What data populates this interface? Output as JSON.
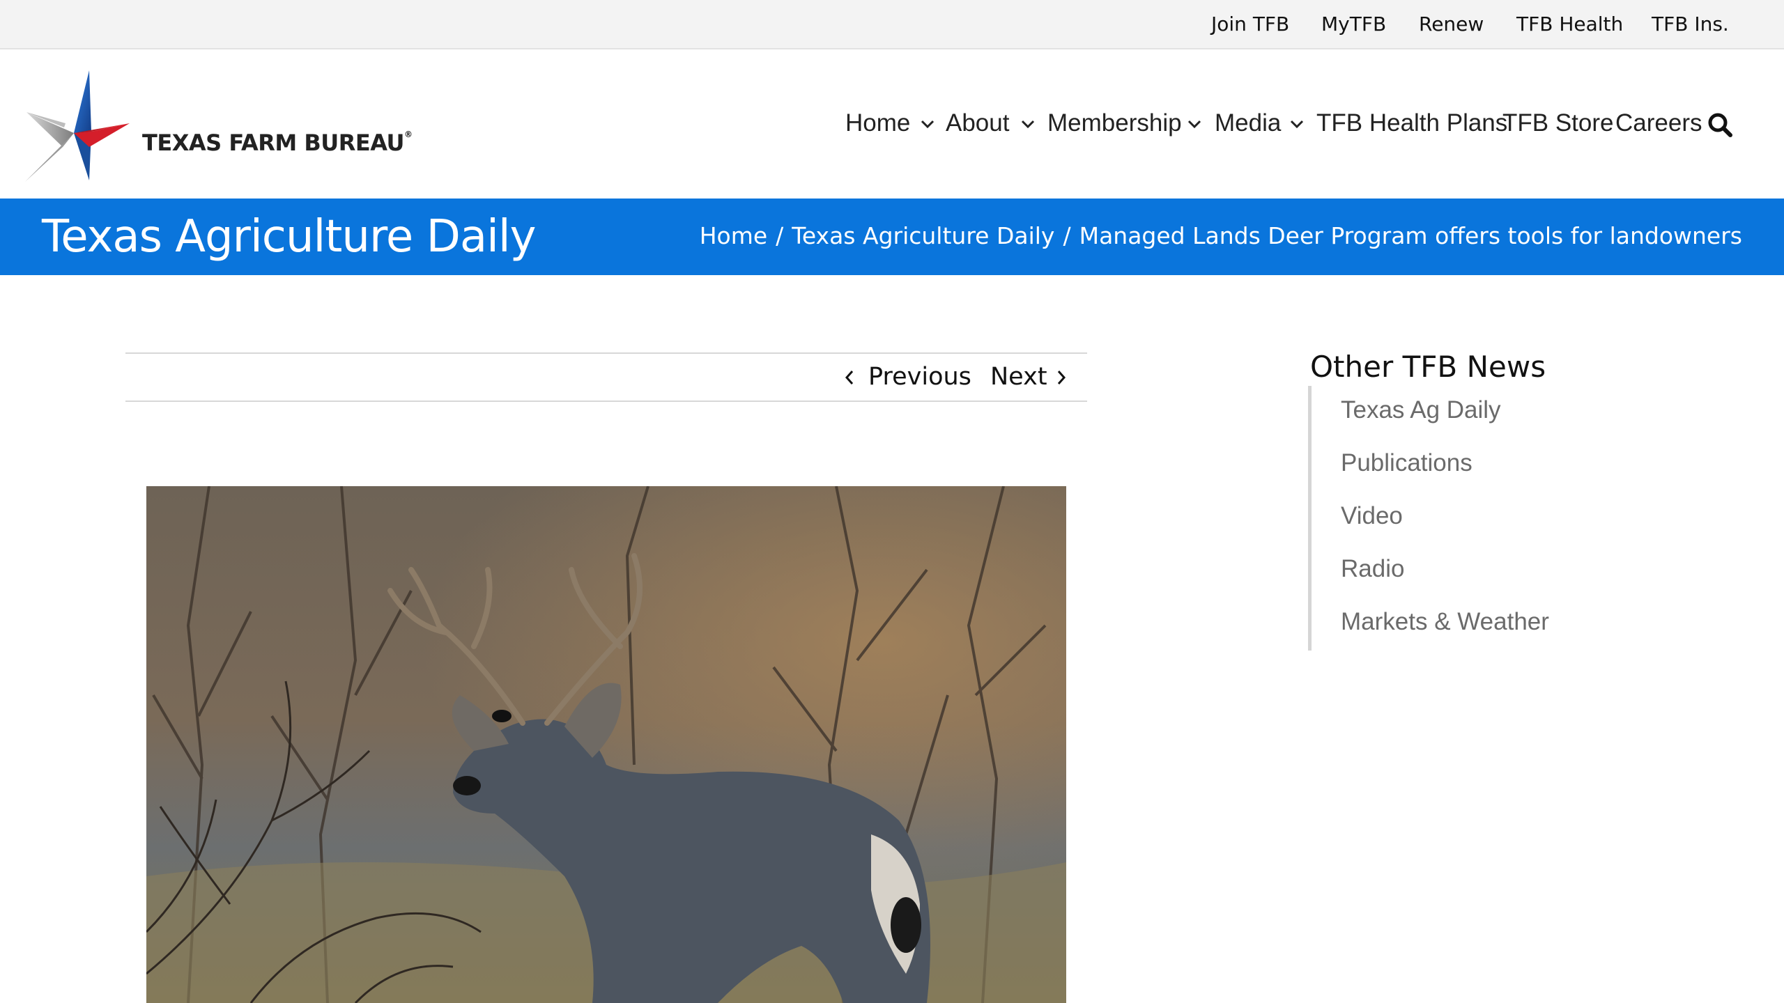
{
  "utility_nav": [
    "Join TFB",
    "MyTFB",
    "Renew",
    "TFB Health",
    "TFB Ins."
  ],
  "logo": {
    "text": "TEXAS FARM BUREAU",
    "reg": "®"
  },
  "main_nav": {
    "home": "Home",
    "about": "About",
    "membership": "Membership",
    "media": "Media",
    "health_plans": "TFB Health Plans",
    "store": "TFB Store",
    "careers": "Careers"
  },
  "titlebar": {
    "title": "Texas Agriculture Daily",
    "breadcrumbs": [
      "Home",
      "Texas Agriculture Daily",
      "Managed Lands Deer Program offers tools for landowners"
    ],
    "separator": "/"
  },
  "post_nav": {
    "previous": "Previous",
    "next": "Next"
  },
  "sidebar": {
    "title": "Other TFB News",
    "items": [
      "Texas Ag Daily",
      "Publications",
      "Video",
      "Radio",
      "Markets & Weather"
    ]
  },
  "colors": {
    "brand_blue": "#0a75dc",
    "star_red": "#e0262f",
    "star_blue": "#1f62b6"
  }
}
